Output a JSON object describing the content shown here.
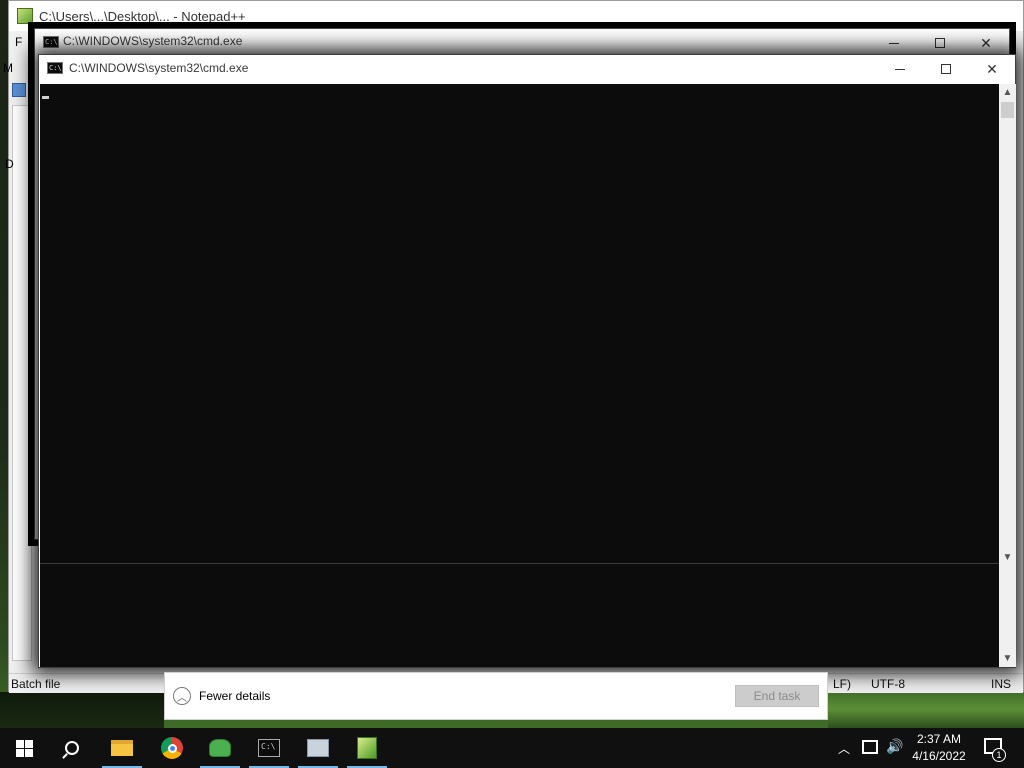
{
  "notepad": {
    "title_fragment": "C:\\Users\\...\\Desktop\\... - Notepad++",
    "menu_fragment": "F",
    "menu_fragment2": "M",
    "side_fragment": "D",
    "status": {
      "file_type": "Batch file",
      "eol": "LF)",
      "encoding": "UTF-8",
      "mode": "INS"
    }
  },
  "cmd_back": {
    "title": "C:\\WINDOWS\\system32\\cmd.exe"
  },
  "cmd_front": {
    "title": "C:\\WINDOWS\\system32\\cmd.exe",
    "icon_text": "C:\\",
    "console_text": ""
  },
  "task_manager": {
    "fewer_details_label": "Fewer details",
    "end_task_label": "End task"
  },
  "taskbar": {
    "items": [
      {
        "name": "start",
        "icon": "windows-logo-icon"
      },
      {
        "name": "search",
        "icon": "search-icon"
      },
      {
        "name": "file-explorer",
        "icon": "folder-icon"
      },
      {
        "name": "chrome",
        "icon": "chrome-icon"
      },
      {
        "name": "frog-app",
        "icon": "frog-icon"
      },
      {
        "name": "command-prompt",
        "icon": "cmd-icon"
      },
      {
        "name": "remote-desktop",
        "icon": "remote-desktop-icon"
      },
      {
        "name": "notepad-plus-plus",
        "icon": "notepad-plus-plus-icon"
      }
    ],
    "clock_time": "2:37 AM",
    "clock_date": "4/16/2022",
    "notification_count": "1"
  },
  "colors": {
    "console_bg": "#0c0c0c",
    "taskbar_bg": "#101010",
    "active_indicator": "#76b9ed"
  }
}
